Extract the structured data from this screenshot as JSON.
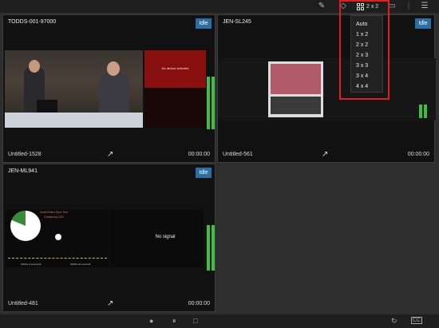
{
  "layout_label": "2 x 2",
  "layout_options": [
    "Auto",
    "1 x 2",
    "2 x 2",
    "2 x 3",
    "3 x 3",
    "3 x 4",
    "4 x 4"
  ],
  "tiles": [
    {
      "title": "TODDS-001-97000",
      "status": "Idle",
      "footer": "Untitled-1528",
      "time": "00:00:00",
      "no_device": "No device selected"
    },
    {
      "title": "JEN-SL245",
      "status": "Idle",
      "footer": "Untitled-561",
      "time": "00:00:00"
    },
    {
      "title": "JEN-ML941",
      "status": "Idle",
      "footer": "Untitled-481",
      "time": "00:00:00",
      "no_signal": "No signal",
      "sync_text": "Audio/Video Sync Test",
      "created_by": "Created by D20",
      "tick_left": "100ths of a second",
      "tick_right": "100ths of a second"
    }
  ],
  "colors": {
    "idle_badge": "#2a6ea4",
    "highlight": "#e01e24",
    "meter": "#3fbf3f"
  }
}
